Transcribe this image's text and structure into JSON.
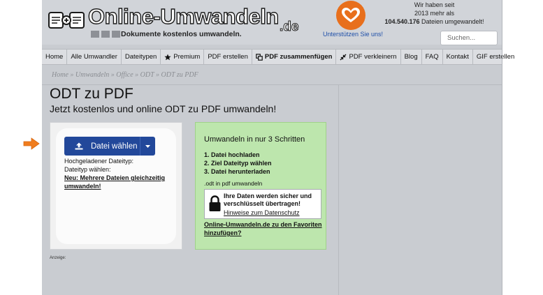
{
  "header": {
    "logo_title": "Online-Umwandeln",
    "logo_tld": ".de",
    "logo_tagline": "Dokumente kostenlos umwandeln.",
    "support_link": "Unterstützen Sie uns!",
    "counter_line1": "Wir haben seit",
    "counter_line2": "2013 mehr als",
    "counter_number": "104.540.176",
    "counter_suffix": " Dateien umgewandelt!",
    "search_placeholder": "Suchen...",
    "accent_color": "#e86f1c"
  },
  "nav": {
    "items": [
      {
        "label": "Home",
        "icon": "",
        "strong": false
      },
      {
        "label": "Alle Umwandler",
        "icon": "",
        "strong": false
      },
      {
        "label": "Dateitypen",
        "icon": "",
        "strong": false
      },
      {
        "label": "Premium",
        "icon": "star-icon",
        "strong": false
      },
      {
        "label": "PDF erstellen",
        "icon": "",
        "strong": false
      },
      {
        "label": "PDF zusammenfügen",
        "icon": "merge-icon",
        "strong": true
      },
      {
        "label": "PDF verkleinern",
        "icon": "compress-icon",
        "strong": false
      },
      {
        "label": "Blog",
        "icon": "",
        "strong": false
      },
      {
        "label": "FAQ",
        "icon": "",
        "strong": false
      },
      {
        "label": "Kontakt",
        "icon": "",
        "strong": false
      },
      {
        "label": "GIF erstellen",
        "icon": "",
        "strong": false
      }
    ]
  },
  "breadcrumb": {
    "items": [
      "Home",
      "Umwandeln",
      "Office",
      "ODT",
      "ODT zu PDF"
    ],
    "separator": " » "
  },
  "main": {
    "title": "ODT zu PDF",
    "subtitle": "Jetzt kostenlos und online ODT zu PDF umwandeln!",
    "upload_button": "Datei wählen",
    "uploaded_type_label": "Hochgeladener Dateityp:",
    "choose_type_label": "Dateityp wählen:",
    "multi_link": "Neu: Mehrere Dateien gleichzeitig umwandeln!",
    "button_color": "#22489a",
    "ad_label": "Anzeige:"
  },
  "steps": {
    "title": "Umwandeln in nur 3 Schritten",
    "items": [
      "1. Datei hochladen",
      "2. Ziel Dateityp wählen",
      "3. Datei herunterladen"
    ],
    "odt_label": ".odt in pdf umwandeln",
    "secure_text": "Ihre Daten werden sicher und verschlüsselt übertragen!",
    "privacy_link": "Hinweise zum Datenschutz",
    "favorites_link": "Online-Umwandeln.de zu den Favoriten hinzufügen?",
    "box_color": "#bde6ad"
  }
}
